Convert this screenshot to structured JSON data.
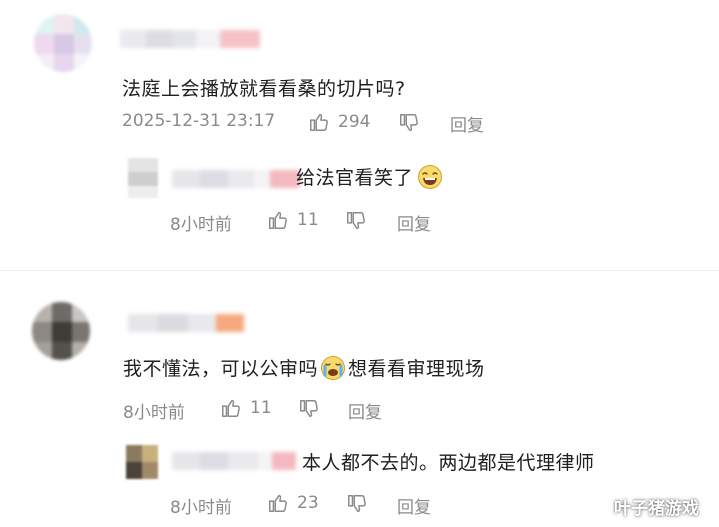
{
  "comments": [
    {
      "text": "法庭上会播放就看看桑的切片吗?",
      "time": "2025-12-31 23:17",
      "likes": "294",
      "reply_label": "回复",
      "replies": [
        {
          "text": "给法官看笑了",
          "time": "8小时前",
          "likes": "11",
          "reply_label": "回复"
        }
      ]
    },
    {
      "text_before": "我不懂法，可以公审吗",
      "text_after": "想看看审理现场",
      "time": "8小时前",
      "likes": "11",
      "reply_label": "回复",
      "replies": [
        {
          "text": "本人都不去的。两边都是代理律师",
          "time": "8小时前",
          "likes": "23",
          "reply_label": "回复"
        }
      ]
    }
  ],
  "watermark": "叶子猪游戏",
  "colors": {
    "meta_gray": "#8a8a8a",
    "text": "#1f1f1f",
    "username_blur_pink": "#f4b8bf",
    "username_blur_orange": "#f6a97e"
  },
  "icons": {
    "like": "thumb-up-icon",
    "dislike": "thumb-down-icon",
    "laugh_emoji": "laughing-emoji-icon",
    "cry_emoji": "crying-emoji-icon"
  }
}
